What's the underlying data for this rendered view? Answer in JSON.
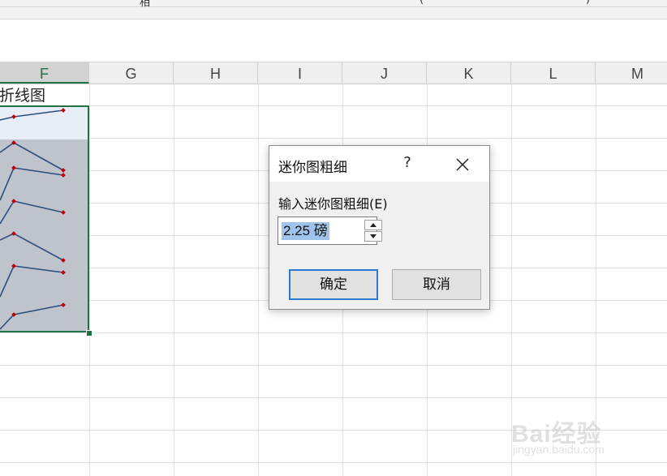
{
  "toolbar": {
    "fragments": [
      "相",
      "(",
      ")"
    ]
  },
  "columns": [
    {
      "label": "F",
      "selected": true
    },
    {
      "label": "G",
      "selected": false
    },
    {
      "label": "H",
      "selected": false
    },
    {
      "label": "I",
      "selected": false
    },
    {
      "label": "J",
      "selected": false
    },
    {
      "label": "K",
      "selected": false
    },
    {
      "label": "L",
      "selected": false
    },
    {
      "label": "M",
      "selected": false
    }
  ],
  "cells": {
    "f_header_text": "k折线图"
  },
  "sparklines": {
    "line_color": "#2f4f7f",
    "marker_color": "#c00000"
  },
  "dialog": {
    "title": "迷你图粗细",
    "help_label": "?",
    "close_icon": "close-icon",
    "input_label": "输入迷你图粗细(E)",
    "value": "2.25 磅",
    "ok_label": "确定",
    "cancel_label": "取消"
  },
  "watermark": {
    "main": "Bai 经验",
    "sub": "jingyan.baidu.com"
  },
  "colors": {
    "selection_border": "#217346",
    "accent": "#2b7bd3"
  }
}
